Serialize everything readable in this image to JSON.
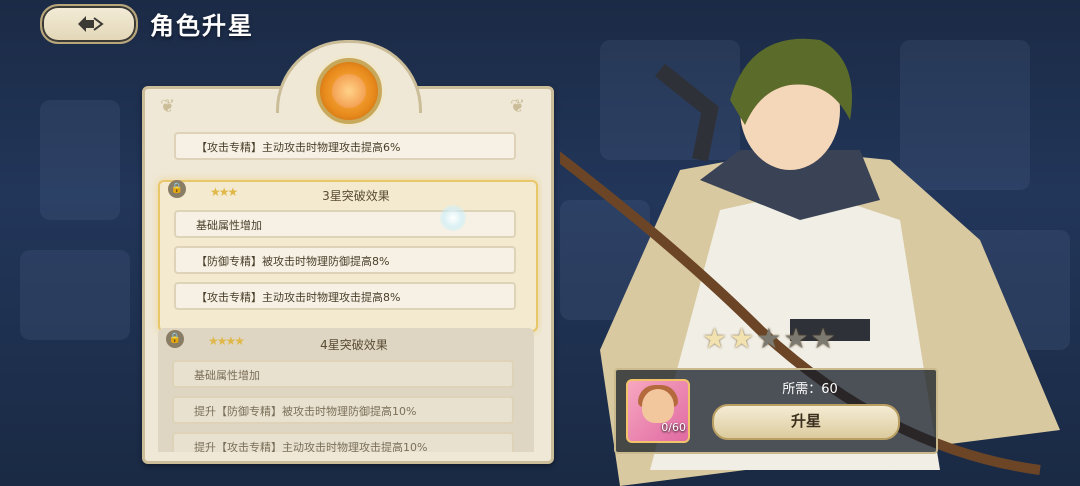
{
  "header": {
    "title": "角色升星"
  },
  "panel": {
    "sections": [
      {
        "rows": [
          "【攻击专精】主动攻击时物理攻击提高6%"
        ]
      },
      {
        "title": "3星突破效果",
        "stars": "★★★",
        "rows": [
          "基础属性增加",
          "【防御专精】被攻击时物理防御提高8%",
          "【攻击专精】主动攻击时物理攻击提高8%"
        ]
      },
      {
        "title": "4星突破效果",
        "stars": "★★★★",
        "rows": [
          "基础属性增加",
          "提升【防御专精】被攻击时物理防御提高10%",
          "提升【攻击专精】主动攻击时物理攻击提高10%"
        ]
      }
    ]
  },
  "hero": {
    "stars_filled": 2,
    "stars_total": 5
  },
  "cost": {
    "need_label": "所需：60",
    "shard_count": "0/60",
    "upgrade_label": "升星"
  },
  "colors": {
    "accent_gold": "#e0b84a",
    "panel_bg": "#efe8d6"
  }
}
